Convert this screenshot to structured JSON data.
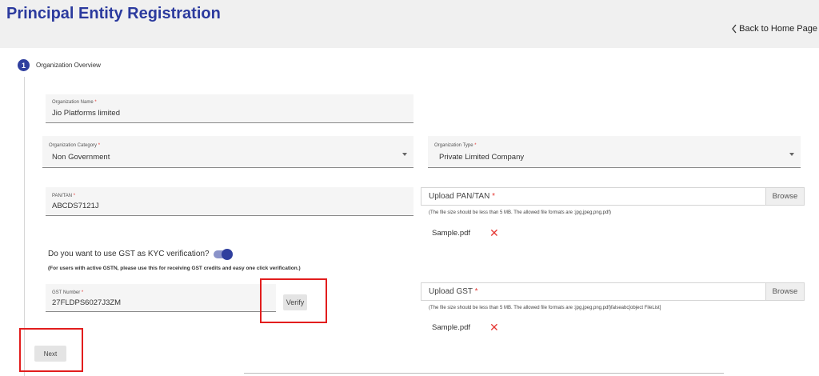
{
  "header": {
    "title": "Principal Entity Registration",
    "back_label": "Back to Home Page"
  },
  "step": {
    "number": "1",
    "label": "Organization Overview"
  },
  "fields": {
    "org_name": {
      "label": "Organization Name",
      "value": "Jio Platforms limited"
    },
    "org_category": {
      "label": "Organization Category",
      "value": "Non Government"
    },
    "org_type": {
      "label": "Organization Type",
      "value": "Private Limited Company"
    },
    "pan_tan": {
      "label": "PAN/TAN",
      "value": "ABCDS7121J"
    },
    "gst_number": {
      "label": "GST Number",
      "value": "27FLDPS6027J3ZM"
    },
    "required_mark": "*"
  },
  "uploads": {
    "pan": {
      "label": "Upload PAN/TAN",
      "browse": "Browse",
      "hint": "(The file size should be less than 5 MB. The allowed file formats are :jpg,jpeg,png,pdf)",
      "file": "Sample.pdf",
      "remove": "✕"
    },
    "gst": {
      "label": "Upload GST",
      "browse": "Browse",
      "hint": "(The file size should be less than 5 MB. The allowed file formats are :jpg,jpeg,png,pdf)falseabc[object FileList]",
      "file": "Sample.pdf",
      "remove": "✕"
    }
  },
  "kyc": {
    "question": "Do you want to use GST as KYC verification?",
    "note": "(For users with active GSTN, please use this for receiving GST credits and easy one click verification.)",
    "toggle_on": true
  },
  "buttons": {
    "verify": "Verify",
    "next": "Next"
  },
  "colors": {
    "title": "#2b3a9e",
    "accent": "#2f3f9e",
    "required": "#e53935",
    "highlight": "#e21d1d"
  }
}
